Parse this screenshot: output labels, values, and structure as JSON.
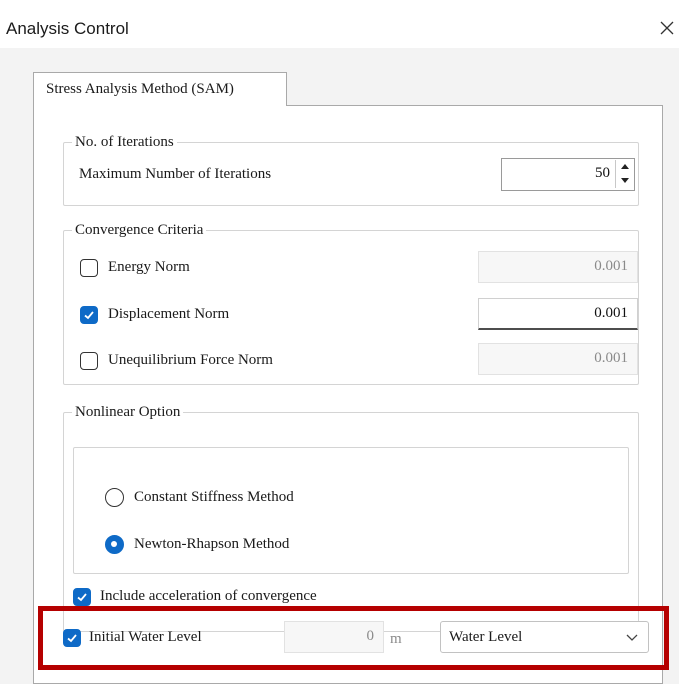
{
  "window": {
    "title": "Analysis Control",
    "close_icon": "close-icon"
  },
  "tabs": [
    {
      "label": "Stress Analysis Method (SAM)",
      "active": true
    }
  ],
  "iterations": {
    "group_label": "No. of Iterations",
    "max_label": "Maximum Number of Iterations",
    "max_value": "50"
  },
  "convergence": {
    "group_label": "Convergence Criteria",
    "items": [
      {
        "label": "Energy Norm",
        "checked": false,
        "value": "0.001",
        "enabled": false
      },
      {
        "label": "Displacement Norm",
        "checked": true,
        "value": "0.001",
        "enabled": true
      },
      {
        "label": "Unequilibrium Force Norm",
        "checked": false,
        "value": "0.001",
        "enabled": false
      }
    ]
  },
  "nonlinear": {
    "group_label": "Nonlinear Option",
    "methods": [
      {
        "label": "Constant Stiffness Method",
        "selected": false
      },
      {
        "label": "Newton-Rhapson Method",
        "selected": true
      }
    ],
    "acceleration_label": "Include acceleration of convergence",
    "acceleration_checked": true
  },
  "water_level": {
    "label": "Initial Water Level",
    "checked": true,
    "value": "0",
    "unit": "m",
    "select_value": "Water Level"
  },
  "colors": {
    "accent": "#0e6ac7",
    "highlight": "#b50000"
  }
}
